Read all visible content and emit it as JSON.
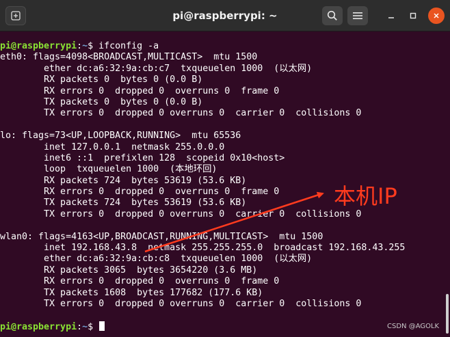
{
  "window": {
    "title": "pi@raspberrypi: ~",
    "colors": {
      "titlebar": "#2d2d2d",
      "terminal_bg": "#300a24",
      "prompt_user": "#8ae234",
      "prompt_path": "#729fcf",
      "close_button": "#e95420",
      "annotation": "#ff3b1e"
    },
    "icons": {
      "new_tab": "new-tab-icon",
      "search": "search-icon",
      "menu": "hamburger-menu-icon",
      "minimize": "minimize-icon",
      "maximize": "maximize-icon",
      "close": "close-icon"
    }
  },
  "terminal": {
    "prompt_user": "pi@raspberrypi",
    "prompt_sep": ":",
    "prompt_path": "~",
    "prompt_end": "$ ",
    "command": "ifconfig -a",
    "output": [
      "eth0: flags=4098<BROADCAST,MULTICAST>  mtu 1500",
      "        ether dc:a6:32:9a:cb:c7  txqueuelen 1000  (以太网)",
      "        RX packets 0  bytes 0 (0.0 B)",
      "        RX errors 0  dropped 0  overruns 0  frame 0",
      "        TX packets 0  bytes 0 (0.0 B)",
      "        TX errors 0  dropped 0 overruns 0  carrier 0  collisions 0",
      "",
      "lo: flags=73<UP,LOOPBACK,RUNNING>  mtu 65536",
      "        inet 127.0.0.1  netmask 255.0.0.0",
      "        inet6 ::1  prefixlen 128  scopeid 0x10<host>",
      "        loop  txqueuelen 1000  (本地环回)",
      "        RX packets 724  bytes 53619 (53.6 KB)",
      "        RX errors 0  dropped 0  overruns 0  frame 0",
      "        TX packets 724  bytes 53619 (53.6 KB)",
      "        TX errors 0  dropped 0 overruns 0  carrier 0  collisions 0",
      "",
      "wlan0: flags=4163<UP,BROADCAST,RUNNING,MULTICAST>  mtu 1500",
      "        inet 192.168.43.8  netmask 255.255.255.0  broadcast 192.168.43.255",
      "        ether dc:a6:32:9a:cb:c8  txqueuelen 1000  (以太网)",
      "        RX packets 3065  bytes 3654220 (3.6 MB)",
      "        RX errors 0  dropped 0  overruns 0  frame 0",
      "        TX packets 1608  bytes 177682 (177.6 KB)",
      "        TX errors 0  dropped 0 overruns 0  carrier 0  collisions 0",
      ""
    ]
  },
  "annotation": {
    "label": "本机IP"
  },
  "watermark": "CSDN @AGOLK"
}
